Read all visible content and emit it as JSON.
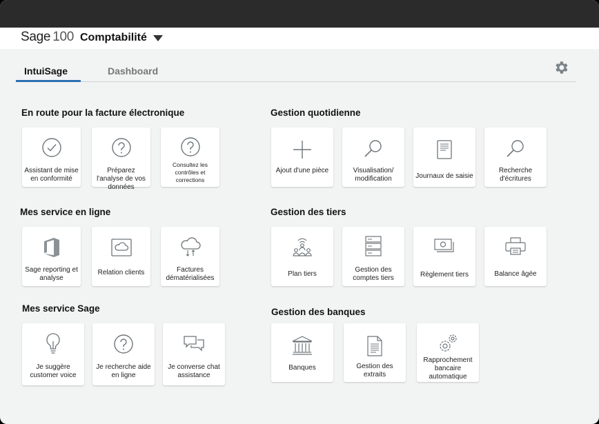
{
  "header": {
    "logo": "Sage",
    "logo_number": "100",
    "module": "Comptabilité"
  },
  "tabs": [
    {
      "label": "IntuiSage"
    },
    {
      "label": "Dashboard"
    }
  ],
  "sections": {
    "facture": {
      "title": "En route pour la facture électronique",
      "tiles": [
        {
          "label": "Assistant de mise en conformité",
          "icon": "check-circle-icon"
        },
        {
          "label": "Préparez l'analyse de vos données",
          "icon": "help-circle-icon"
        },
        {
          "label": "Consultez les contrôles et corrections",
          "icon": "help-circle-icon"
        }
      ]
    },
    "en_ligne": {
      "title": "Mes service en ligne",
      "tiles": [
        {
          "label": "Sage reporting et analyse",
          "icon": "office-icon"
        },
        {
          "label": "Relation clients",
          "icon": "cloud-box-icon"
        },
        {
          "label": "Factures dématérialisées",
          "icon": "cloud-transfer-icon"
        }
      ]
    },
    "sage": {
      "title": "Mes service Sage",
      "tiles": [
        {
          "label": "Je suggère customer voice",
          "icon": "lightbulb-icon"
        },
        {
          "label": "Je recherche aide en ligne",
          "icon": "help-circle-icon"
        },
        {
          "label": "Je converse chat assistance",
          "icon": "chat-icon"
        }
      ]
    },
    "quotidienne": {
      "title": "Gestion quotidienne",
      "tiles": [
        {
          "label": "Ajout d'une pièce",
          "icon": "plus-icon"
        },
        {
          "label": "Visualisation/ modification",
          "icon": "search-icon"
        },
        {
          "label": "Journaux de saisie",
          "icon": "journal-icon"
        },
        {
          "label": "Recherche d'écritures",
          "icon": "search-icon"
        }
      ]
    },
    "tiers": {
      "title": "Gestion des tiers",
      "tiles": [
        {
          "label": "Plan tiers",
          "icon": "people-network-icon"
        },
        {
          "label": "Gestion des comptes tiers",
          "icon": "server-icon"
        },
        {
          "label": "Règlement tiers",
          "icon": "banknotes-icon"
        },
        {
          "label": "Balance âgée",
          "icon": "printer-icon"
        }
      ]
    },
    "banques": {
      "title": "Gestion des banques",
      "tiles": [
        {
          "label": "Banques",
          "icon": "bank-icon"
        },
        {
          "label": "Gestion des extraits",
          "icon": "document-icon"
        },
        {
          "label": "Rapprochement bancaire automatique",
          "icon": "gears-icon"
        }
      ]
    }
  }
}
